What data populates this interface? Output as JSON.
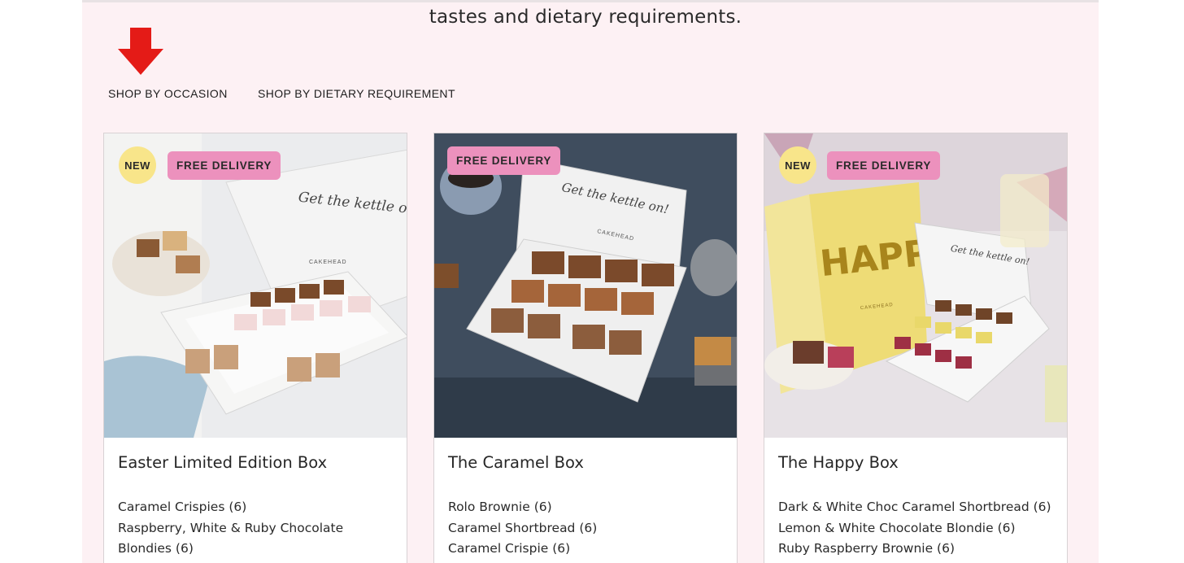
{
  "header": {
    "tagline": "tastes and dietary requirements."
  },
  "annotation": {
    "arrow_icon": "down-arrow-icon",
    "arrow_color": "#e41b17"
  },
  "tabs": [
    {
      "label": "SHOP BY OCCASION"
    },
    {
      "label": "SHOP BY DIETARY REQUIREMENT"
    }
  ],
  "colors": {
    "page_background": "#fdf1f4",
    "badge_new": "#f8e58a",
    "badge_free_delivery": "#ec91bd"
  },
  "products": [
    {
      "title": "Easter Limited Edition Box",
      "badge_new": "NEW",
      "badge_delivery": "FREE DELIVERY",
      "box_text": "Get the kettle on!",
      "brand": "CAKEHEAD",
      "items": [
        "Caramel Crispies (6)",
        "Raspberry, White & Ruby Chocolate Blondies (6)"
      ]
    },
    {
      "title": "The Caramel Box",
      "badge_delivery": "FREE DELIVERY",
      "box_text": "Get the kettle on!",
      "brand": "CAKEHEAD",
      "items": [
        "Rolo Brownie (6)",
        "Caramel Shortbread (6)",
        "Caramel Crispie (6)"
      ]
    },
    {
      "title": "The Happy Box",
      "badge_new": "NEW",
      "badge_delivery": "FREE DELIVERY",
      "box_text": "Get the kettle on!",
      "lid_text": "HAPPY",
      "brand": "CAKEHEAD",
      "items": [
        "Dark & White Choc Caramel Shortbread (6)",
        "Lemon & White Chocolate Blondie (6)",
        "Ruby Raspberry Brownie (6)"
      ]
    }
  ]
}
